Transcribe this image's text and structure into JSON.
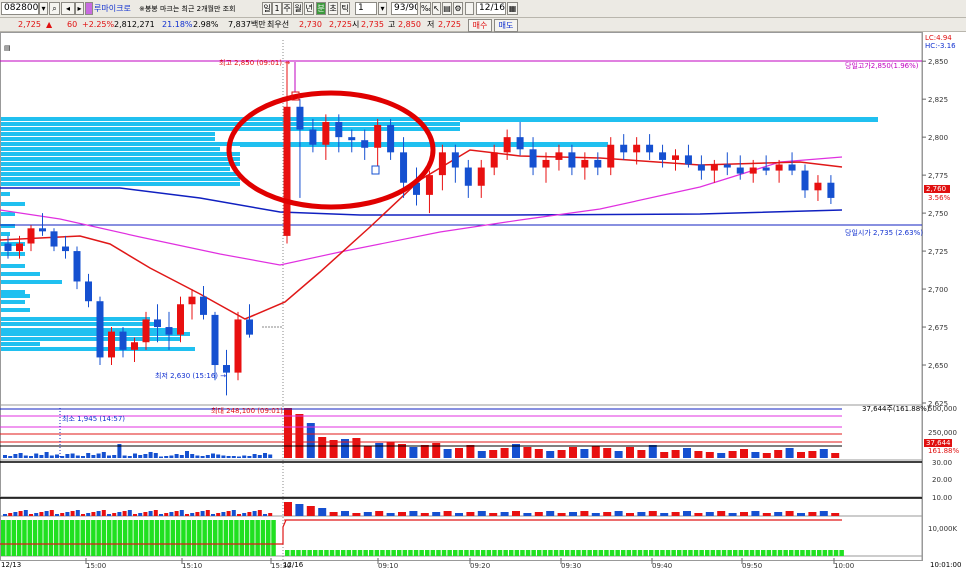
{
  "toolbar": {
    "code": "082800",
    "stock_name": "루마이크로",
    "notice": "※봉봉 마크는 최근 2개월만 조회",
    "period_buttons": [
      "일",
      "1",
      "주",
      "월",
      "년",
      "분",
      "초",
      "틱"
    ],
    "interval_value": "1",
    "count_value": "93/900",
    "date_value": "12/16"
  },
  "quote": {
    "price": "2,725",
    "change": "60",
    "change_pct": "+2.25%",
    "volume": "2,812,271",
    "vol_ratio": "21.18%",
    "turnover": "2.98%",
    "amount": "7,837백만",
    "best_bid_label": "최우선",
    "best_bid": "2,730",
    "best_ask": "2,725",
    "open_label": "시",
    "open": "2,735",
    "high_label": "고",
    "high": "2,850",
    "low_label": "저",
    "low": "2,725",
    "buy_label": "매수",
    "sell_label": "매도"
  },
  "annotations": {
    "high_marker": "최고 2,850 (09:01) →",
    "low_marker": "최저 2,630 (15:16) →",
    "today_high": "당일고가2,850(1.96%)",
    "today_open": "당일시가 2,735 (2.63%)",
    "vol_max": "최대 248,100 (09:01)",
    "vol_min": "최소 1,945 (14:57)",
    "vol_current": "37,644주(161.88%)",
    "lc": "LC:4.94",
    "hc": "HC:-3.16",
    "current_price": "2,760",
    "current_pct": "3.56%",
    "vol_badge": "37,644",
    "vol_badge_pct": "161.88%",
    "date_left": "12/13",
    "date_mid": "12/16",
    "time_right": "10:01:00"
  },
  "price_axis": [
    "2,850",
    "2,825",
    "2,800",
    "2,775",
    "2,750",
    "2,725",
    "2,700",
    "2,675",
    "2,650",
    "2,625"
  ],
  "volume_axis": [
    "500,000",
    "250,000"
  ],
  "ind_axis": [
    "30.00",
    "20.00",
    "10.00"
  ],
  "bot_axis": [
    "10,000K"
  ],
  "time_axis": [
    "15:00",
    "15:10",
    "15:30",
    "09:10",
    "09:20",
    "09:30",
    "09:40",
    "09:50",
    "10:00"
  ],
  "colors": {
    "up": "#e81010",
    "down": "#1550d0",
    "ma5": "#e01818",
    "ma20": "#e030e0",
    "ma60": "#1020c0",
    "profile": "#20c0f0",
    "highlight": "#e00000"
  },
  "chart_data": {
    "type": "candlestick",
    "price_range": [
      2625,
      2860
    ],
    "series": [
      {
        "name": "12/13",
        "candles": [
          [
            2730,
            2735,
            2720,
            2725
          ],
          [
            2725,
            2735,
            2720,
            2730
          ],
          [
            2730,
            2742,
            2725,
            2740
          ],
          [
            2740,
            2750,
            2735,
            2738
          ],
          [
            2738,
            2740,
            2725,
            2728
          ],
          [
            2728,
            2735,
            2720,
            2725
          ],
          [
            2725,
            2728,
            2700,
            2705
          ],
          [
            2705,
            2710,
            2688,
            2692
          ],
          [
            2692,
            2695,
            2650,
            2655
          ],
          [
            2655,
            2675,
            2650,
            2672
          ],
          [
            2672,
            2675,
            2655,
            2660
          ],
          [
            2660,
            2668,
            2652,
            2665
          ],
          [
            2665,
            2685,
            2660,
            2680
          ],
          [
            2680,
            2690,
            2665,
            2675
          ],
          [
            2675,
            2685,
            2660,
            2670
          ],
          [
            2670,
            2695,
            2665,
            2690
          ],
          [
            2690,
            2700,
            2680,
            2695
          ],
          [
            2695,
            2702,
            2680,
            2683
          ],
          [
            2683,
            2685,
            2640,
            2650
          ],
          [
            2650,
            2660,
            2630,
            2645
          ],
          [
            2645,
            2685,
            2640,
            2680
          ],
          [
            2680,
            2690,
            2668,
            2670
          ]
        ]
      },
      {
        "name": "12/16",
        "candles": [
          [
            2735,
            2850,
            2730,
            2820
          ],
          [
            2820,
            2825,
            2760,
            2805
          ],
          [
            2805,
            2812,
            2790,
            2795
          ],
          [
            2795,
            2815,
            2785,
            2810
          ],
          [
            2810,
            2815,
            2790,
            2800
          ],
          [
            2800,
            2805,
            2790,
            2798
          ],
          [
            2798,
            2805,
            2785,
            2793
          ],
          [
            2793,
            2812,
            2780,
            2808
          ],
          [
            2808,
            2812,
            2785,
            2790
          ],
          [
            2790,
            2800,
            2760,
            2770
          ],
          [
            2770,
            2780,
            2755,
            2762
          ],
          [
            2762,
            2778,
            2750,
            2775
          ],
          [
            2775,
            2795,
            2765,
            2790
          ],
          [
            2790,
            2795,
            2770,
            2780
          ],
          [
            2780,
            2785,
            2760,
            2768
          ],
          [
            2768,
            2785,
            2760,
            2780
          ],
          [
            2780,
            2795,
            2775,
            2790
          ],
          [
            2790,
            2805,
            2785,
            2800
          ],
          [
            2800,
            2810,
            2788,
            2792
          ],
          [
            2792,
            2800,
            2775,
            2780
          ],
          [
            2780,
            2790,
            2770,
            2785
          ],
          [
            2785,
            2795,
            2778,
            2790
          ],
          [
            2790,
            2795,
            2775,
            2780
          ],
          [
            2780,
            2790,
            2772,
            2785
          ],
          [
            2785,
            2790,
            2775,
            2780
          ],
          [
            2780,
            2800,
            2775,
            2795
          ],
          [
            2795,
            2802,
            2785,
            2790
          ],
          [
            2790,
            2800,
            2782,
            2795
          ],
          [
            2795,
            2802,
            2785,
            2790
          ],
          [
            2790,
            2795,
            2780,
            2785
          ],
          [
            2785,
            2792,
            2778,
            2788
          ],
          [
            2788,
            2795,
            2780,
            2782
          ],
          [
            2782,
            2788,
            2772,
            2778
          ],
          [
            2778,
            2785,
            2770,
            2782
          ],
          [
            2782,
            2790,
            2775,
            2780
          ],
          [
            2780,
            2788,
            2772,
            2776
          ],
          [
            2776,
            2785,
            2770,
            2780
          ],
          [
            2780,
            2788,
            2775,
            2778
          ],
          [
            2778,
            2785,
            2770,
            2782
          ],
          [
            2782,
            2790,
            2775,
            2778
          ],
          [
            2778,
            2782,
            2760,
            2765
          ],
          [
            2765,
            2775,
            2758,
            2770
          ],
          [
            2770,
            2775,
            2756,
            2760
          ]
        ]
      }
    ],
    "volume_bars": [
      6,
      4,
      8,
      10,
      5,
      4,
      9,
      6,
      12,
      5,
      7,
      4,
      8,
      9,
      5,
      4,
      10,
      6,
      9,
      12,
      5,
      6,
      28,
      5,
      4,
      9,
      6,
      8,
      12,
      10,
      3,
      4,
      5,
      8,
      6,
      14,
      8,
      5,
      4,
      6,
      9,
      7,
      5,
      4,
      4,
      3,
      5,
      4,
      8,
      6,
      10,
      7,
      100,
      88,
      70,
      42,
      36,
      38,
      40,
      24,
      30,
      32,
      28,
      22,
      26,
      30,
      18,
      20,
      26,
      14,
      16,
      20,
      28,
      22,
      18,
      14,
      16,
      22,
      18,
      24,
      20,
      14,
      22,
      16,
      26,
      12,
      16,
      20,
      14,
      12,
      10,
      14,
      18,
      12,
      10,
      16,
      20,
      12,
      14,
      18,
      10
    ]
  }
}
